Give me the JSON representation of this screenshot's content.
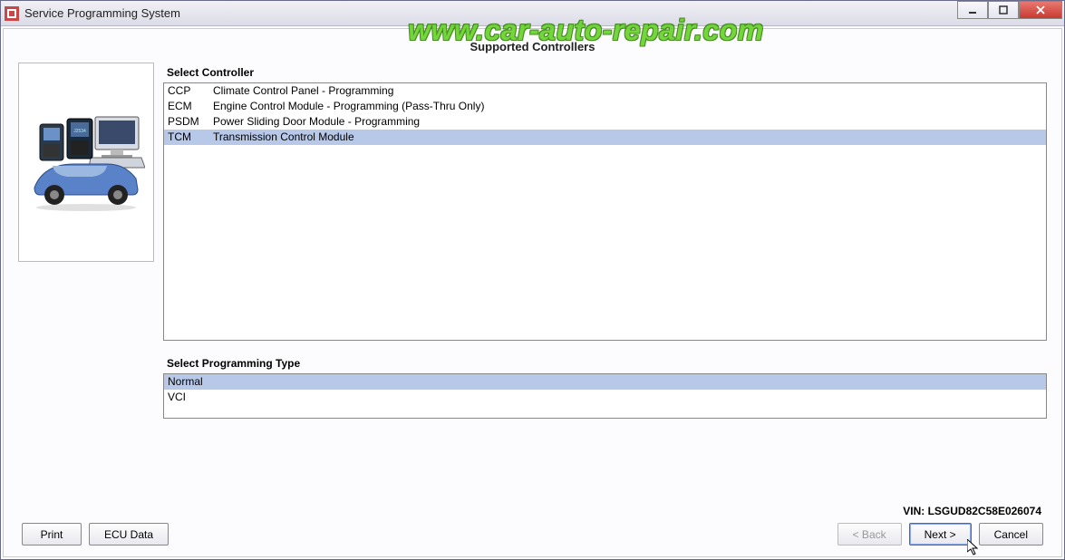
{
  "window": {
    "title": "Service Programming System"
  },
  "page": {
    "title": "Supported Controllers"
  },
  "controller_panel": {
    "label": "Select Controller",
    "items": [
      {
        "code": "CCP",
        "desc": "Climate Control Panel - Programming"
      },
      {
        "code": "ECM",
        "desc": "Engine Control Module - Programming (Pass-Thru Only)"
      },
      {
        "code": "PSDM",
        "desc": "Power Sliding Door Module - Programming"
      },
      {
        "code": "TCM",
        "desc": "Transmission Control Module"
      }
    ],
    "selected_index": 3
  },
  "progtype_panel": {
    "label": "Select Programming Type",
    "items": [
      {
        "label": "Normal"
      },
      {
        "label": "VCI"
      }
    ],
    "selected_index": 0
  },
  "vin": {
    "label": "VIN:",
    "value": "LSGUD82C58E026074"
  },
  "buttons": {
    "print": "Print",
    "ecu_data": "ECU Data",
    "back": "< Back",
    "next": "Next >",
    "cancel": "Cancel"
  },
  "watermark": "www.car-auto-repair.com"
}
